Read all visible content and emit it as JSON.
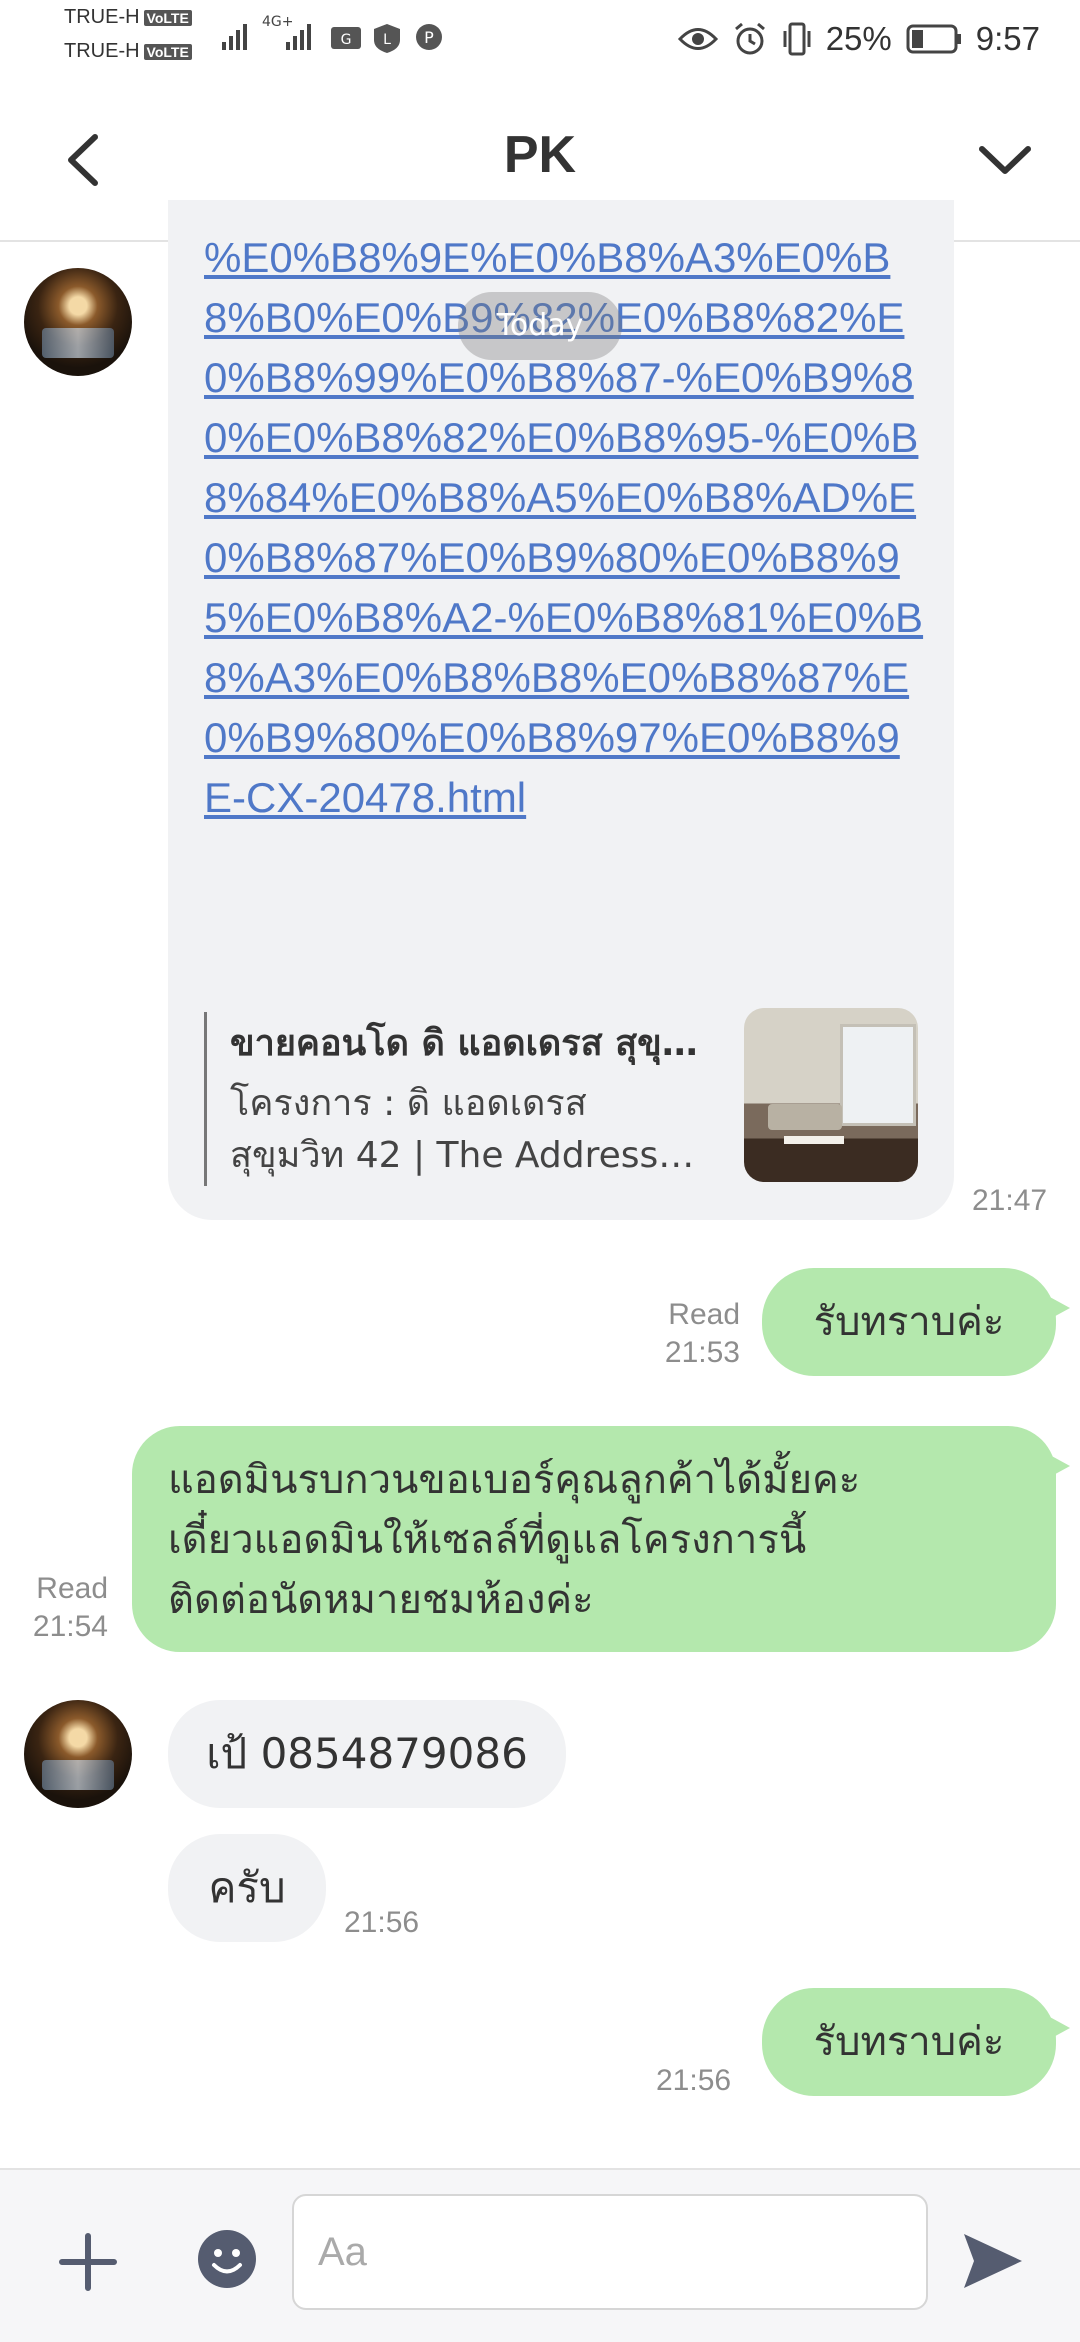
{
  "status_bar": {
    "carrier1": "TRUE-H",
    "carrier2": "TRUE-H",
    "volte": "VoLTE",
    "network": "4G+",
    "battery": "25%",
    "time": "9:57"
  },
  "header": {
    "title": "PK"
  },
  "divider": "Today",
  "messages": {
    "link": {
      "text": "%E0%B8%9E%E0%B8%A3%E0%B8%B0%E0%B9%82%E0%B8%82%E0%B8%99%E0%B8%87-%E0%B9%80%E0%B8%82%E0%B8%95-%E0%B8%84%E0%B8%A5%E0%B8%AD%E0%B8%87%E0%B9%80%E0%B8%95%E0%B8%A2-%E0%B8%81%E0%B8%A3%E0%B8%B8%E0%B8%87%E0%B9%80%E0%B8%97%E0%B8%9E-CX-20478.html",
      "preview_title": "ขายคอนโด ดิ แอดเดรส สุขุมวิท 42",
      "preview_desc": "โครงการ : ดิ แอดเดรส สุขุมวิท 42 | The Address Sukhumvit 42",
      "time": "21:47"
    },
    "ack1": {
      "text": "รับทราบค่ะ",
      "read": "Read",
      "time": "21:53"
    },
    "request": {
      "line1": "แอดมินรบกวนขอเบอร์คุณลูกค้าได้มั้ยคะ",
      "line2": "เดี๋ยวแอดมินให้เซลล์ที่ดูแลโครงการนี้",
      "line3": "ติดต่อนัดหมายชมห้องค่ะ",
      "read": "Read",
      "time": "21:54"
    },
    "phone": {
      "text": "เป้ 0854879086"
    },
    "krub": {
      "text": "ครับ",
      "time": "21:56"
    },
    "ack2": {
      "text": "รับทราบค่ะ",
      "time": "21:56"
    }
  },
  "input": {
    "placeholder": "Aa"
  }
}
